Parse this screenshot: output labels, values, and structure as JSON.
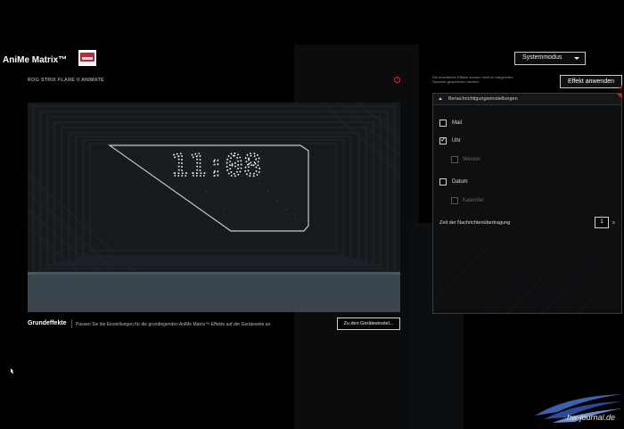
{
  "app": {
    "title": "AniMe Matrix™",
    "mode_select": "Systemmodus",
    "device_name": "ROG STRIX FLARE II ANIMATE"
  },
  "preview": {
    "clock_text": "11:08"
  },
  "basic_effects": {
    "title": "Grundeffekte",
    "description": "Passen Sie die Einstellungen für die grundlegenden AniMe Matrix™-Effekte auf der Geräteseite an.",
    "button_label": "Zu den Geräteeinstel..."
  },
  "right_panel": {
    "note": "Die erweiterten Effekte können nicht im integrierten Speicher gespeichert werden.",
    "apply_button": "Effekt anwenden",
    "section_title": "Benachrichtigungseinstellungen",
    "options": [
      {
        "label": "Mail",
        "checked": false,
        "disabled": false
      },
      {
        "label": "Uhr",
        "checked": true,
        "disabled": false
      },
      {
        "label": "Wecker",
        "checked": false,
        "disabled": true
      },
      {
        "label": "Datum",
        "checked": false,
        "disabled": false
      },
      {
        "label": "Kalender",
        "checked": false,
        "disabled": true
      }
    ],
    "interval_label": "Zeit der Nachrichtenübertragung",
    "interval_value": "1",
    "interval_unit": "s"
  },
  "watermark": {
    "text": "hw-journal.de"
  },
  "colors": {
    "accent": "#d01e32",
    "background": "#000000",
    "panel": "#0d0f11"
  }
}
